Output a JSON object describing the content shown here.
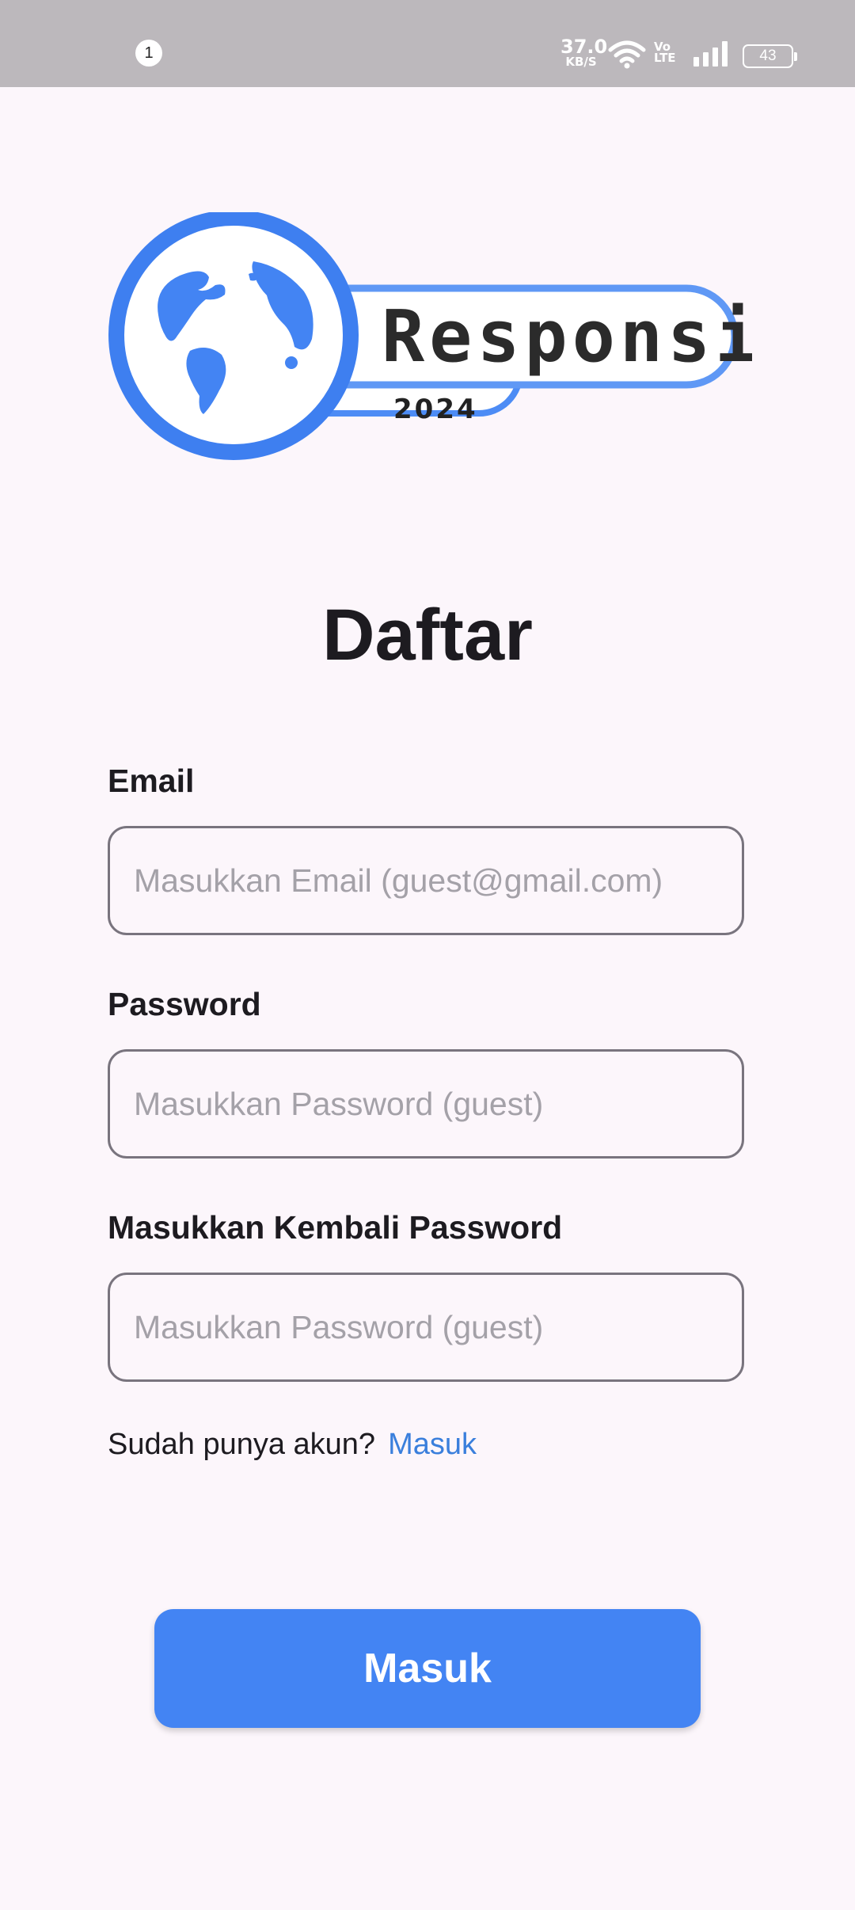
{
  "status_bar": {
    "notification_count": "1",
    "net_speed_value": "37.0",
    "net_speed_unit": "KB/S",
    "volte_line1": "Vo",
    "volte_line2": "LTE",
    "battery_level": "43",
    "icons": [
      "wifi-icon",
      "signal-icon",
      "battery-icon"
    ]
  },
  "logo": {
    "word": "Responsi",
    "year": "2024",
    "icon": "globe-icon",
    "accent_color": "#4384f3"
  },
  "page": {
    "title": "Daftar"
  },
  "form": {
    "email_label": "Email",
    "email_placeholder": "Masukkan Email (guest@gmail.com)",
    "password_label": "Password",
    "password_placeholder": "Masukkan Password (guest)",
    "confirm_label": "Masukkan Kembali Password",
    "confirm_placeholder": "Masukkan Password (guest)"
  },
  "signin_prompt": {
    "text": "Sudah punya akun?",
    "link": "Masuk"
  },
  "submit_button": {
    "label": "Masuk"
  }
}
